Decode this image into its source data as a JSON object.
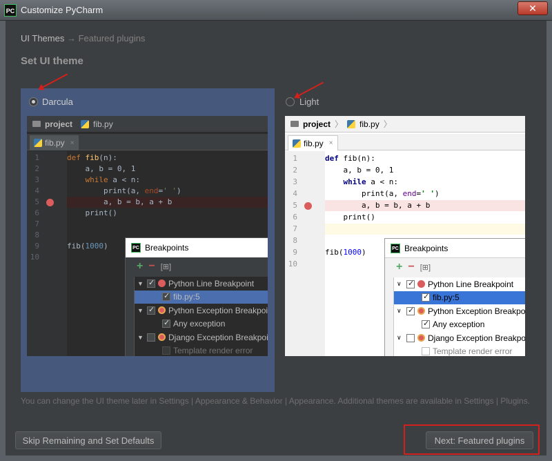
{
  "window": {
    "title": "Customize PyCharm",
    "app_icon": "PC",
    "close_label": "✕"
  },
  "breadcrumb": {
    "current": "UI Themes",
    "separator": "→",
    "next": "Featured plugins"
  },
  "section_title": "Set UI theme",
  "themes": {
    "darcula": {
      "label": "Darcula",
      "selected": true
    },
    "light": {
      "label": "Light",
      "selected": false
    }
  },
  "preview": {
    "project_label": "project",
    "file_name": "fib.py",
    "tab_close": "×",
    "line_numbers": [
      "1",
      "2",
      "3",
      "4",
      "5",
      "6",
      "7",
      "8",
      "9",
      "10"
    ],
    "code": {
      "l1_kw": "def ",
      "l1_fn": "fib",
      "l1_rest": "(n):",
      "l2": "    a, b = 0, 1",
      "l3_kw": "    while ",
      "l3_rest": "a < n:",
      "l4_a": "        print(a, ",
      "l4_param": "end",
      "l4_eq": "=",
      "l4_str": "' '",
      "l4_close": ")",
      "l5": "        a, b = b, a + b",
      "l6": "    print()",
      "l9_a": "fib(",
      "l9_num": "1000",
      "l9_b": ")"
    },
    "breakpoints_dialog": {
      "title": "Breakpoints",
      "pc_icon": "PC",
      "add": "+",
      "remove": "−",
      "group": "[⊞]",
      "items": [
        {
          "label": "Python Line Breakpoint"
        },
        {
          "label": "fib.py:5"
        },
        {
          "label": "Python Exception Breakpoi"
        },
        {
          "label": "Any exception"
        },
        {
          "label": "Django Exception Breakpoi"
        },
        {
          "label": "Template render error"
        }
      ]
    }
  },
  "hint": "You can change the UI theme later in Settings | Appearance & Behavior | Appearance. Additional themes are available in Settings | Plugins.",
  "buttons": {
    "skip": "Skip Remaining and Set Defaults",
    "next": "Next: Featured plugins"
  },
  "colors": {
    "annotation_red": "#d2211c",
    "selection_blue": "#4b6eaf",
    "breakpoint_red": "#db5c5c"
  }
}
